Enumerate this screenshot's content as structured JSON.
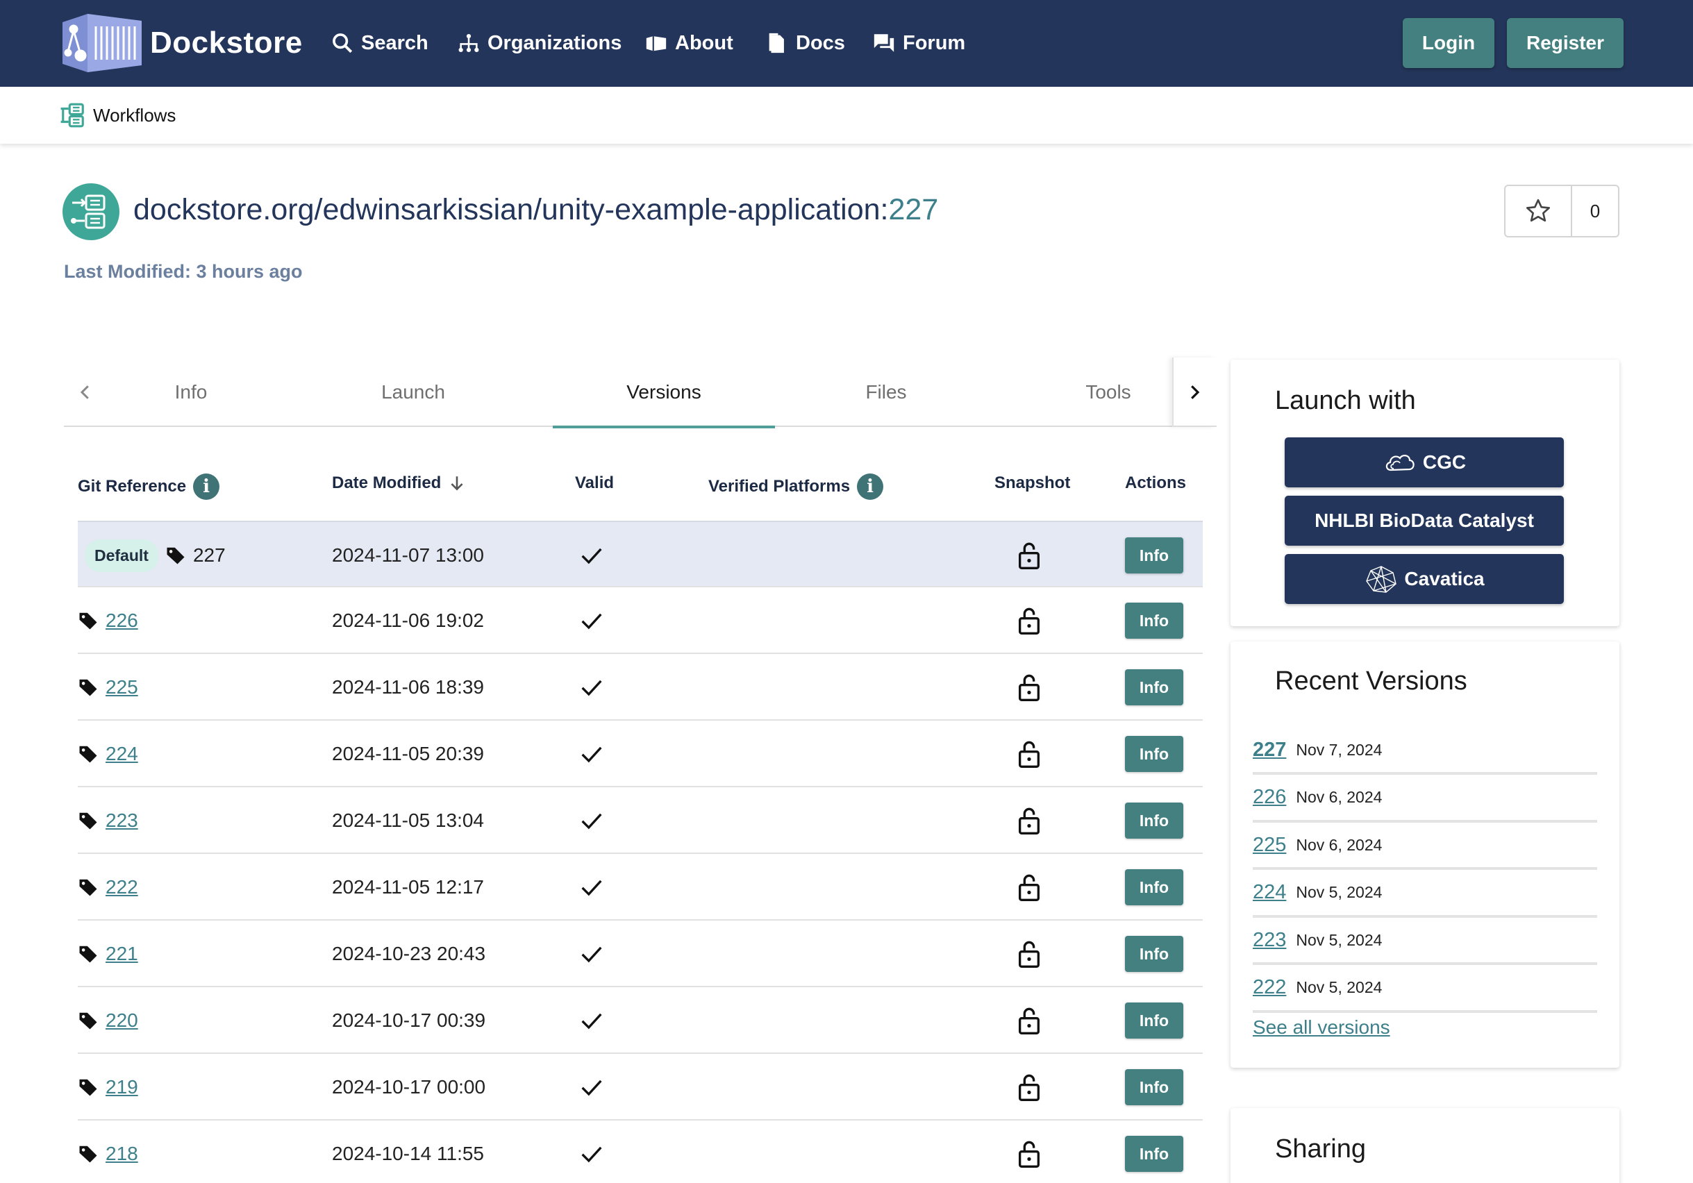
{
  "navbar": {
    "brand": "Dockstore",
    "links": [
      {
        "label": "Search",
        "icon": "search-icon"
      },
      {
        "label": "Organizations",
        "icon": "organizations-icon"
      },
      {
        "label": "About",
        "icon": "about-icon"
      },
      {
        "label": "Docs",
        "icon": "docs-icon"
      },
      {
        "label": "Forum",
        "icon": "forum-icon"
      }
    ],
    "login": "Login",
    "register": "Register"
  },
  "breadcrumb": {
    "label": "Workflows"
  },
  "workflow": {
    "path": "dockstore.org/edwinsarkissian/unity-example-application:",
    "version": "227",
    "last_modified": "Last Modified: 3 hours ago",
    "stars": "0"
  },
  "tabs": [
    "Info",
    "Launch",
    "Versions",
    "Files",
    "Tools"
  ],
  "active_tab": "Versions",
  "table": {
    "headers": {
      "git_reference": "Git Reference",
      "date_modified": "Date Modified",
      "valid": "Valid",
      "verified_platforms": "Verified Platforms",
      "snapshot": "Snapshot",
      "actions": "Actions"
    },
    "default_badge": "Default",
    "action_label": "Info",
    "rows": [
      {
        "ref": "227",
        "date": "2024-11-07 13:00"
      },
      {
        "ref": "226",
        "date": "2024-11-06 19:02"
      },
      {
        "ref": "225",
        "date": "2024-11-06 18:39"
      },
      {
        "ref": "224",
        "date": "2024-11-05 20:39"
      },
      {
        "ref": "223",
        "date": "2024-11-05 13:04"
      },
      {
        "ref": "222",
        "date": "2024-11-05 12:17"
      },
      {
        "ref": "221",
        "date": "2024-10-23 20:43"
      },
      {
        "ref": "220",
        "date": "2024-10-17 00:39"
      },
      {
        "ref": "219",
        "date": "2024-10-17 00:00"
      },
      {
        "ref": "218",
        "date": "2024-10-14 11:55"
      }
    ]
  },
  "launch_with": {
    "title": "Launch with",
    "buttons": [
      "CGC",
      "NHLBI BioData Catalyst",
      "Cavatica"
    ]
  },
  "recent_versions": {
    "title": "Recent Versions",
    "items": [
      {
        "ver": "227",
        "date": "Nov 7, 2024"
      },
      {
        "ver": "226",
        "date": "Nov 6, 2024"
      },
      {
        "ver": "225",
        "date": "Nov 6, 2024"
      },
      {
        "ver": "224",
        "date": "Nov 5, 2024"
      },
      {
        "ver": "223",
        "date": "Nov 5, 2024"
      },
      {
        "ver": "222",
        "date": "Nov 5, 2024"
      }
    ],
    "see_all": "See all versions"
  },
  "sharing": {
    "title": "Sharing"
  },
  "colors": {
    "navbar": "#23355a",
    "accent": "#43807f",
    "link": "#3d7f8a",
    "selected_row": "#e4e9f4"
  }
}
